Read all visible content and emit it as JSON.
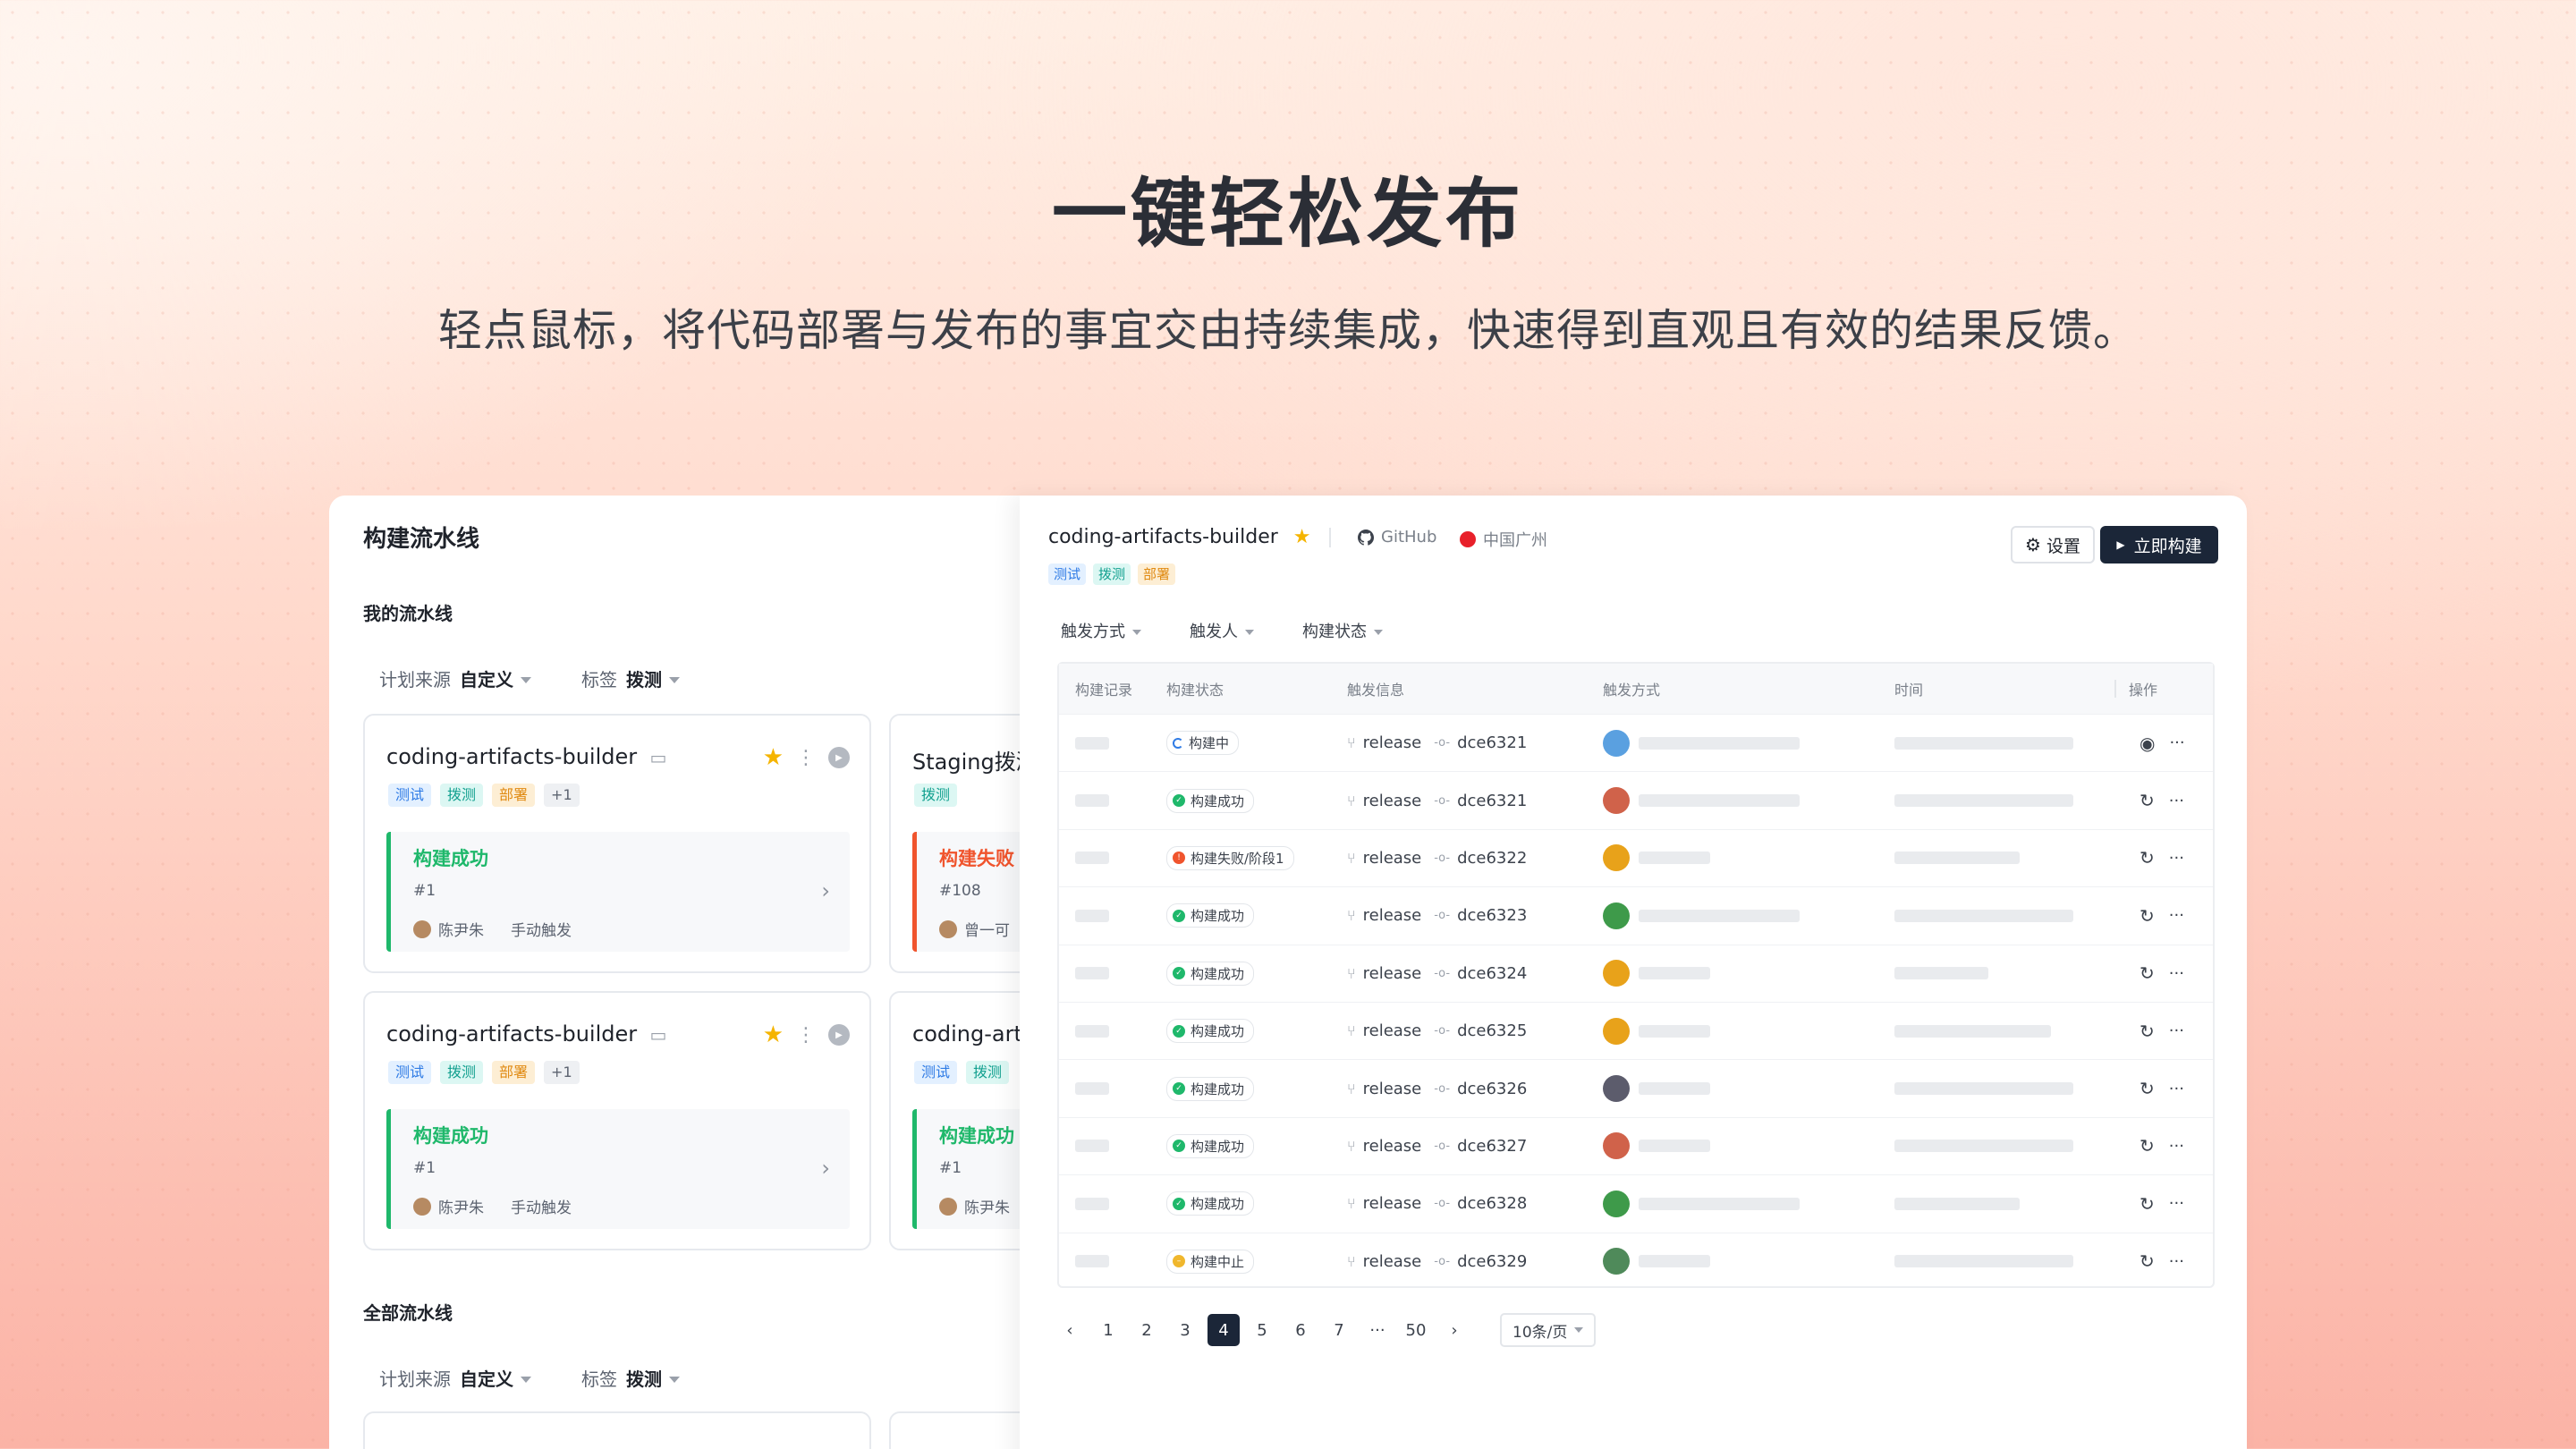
{
  "hero": {
    "title": "一键轻松发布",
    "subtitle": "轻点鼠标，将代码部署与发布的事宜交由持续集成，快速得到直观且有效的结果反馈。"
  },
  "left": {
    "title": "构建流水线",
    "my_section": "我的流水线",
    "all_section": "全部流水线",
    "filters": {
      "source_label": "计划来源",
      "source_value": "自定义",
      "tag_label": "标签",
      "tag_value": "拨测"
    },
    "cards": [
      {
        "name": "coding-artifacts-builder",
        "tags": [
          "测试",
          "拨测",
          "部署",
          "+1"
        ],
        "status": "构建成功",
        "status_color": "#1fb86b",
        "number": "#1",
        "user": "陈尹朱",
        "trigger": "手动触发",
        "starred": true
      },
      {
        "name": "Staging拨测",
        "tags": [
          "拨测"
        ],
        "status": "构建失败",
        "status_color": "#f0542d",
        "number": "#108",
        "user": "曾一可",
        "trigger": ""
      },
      {
        "name": "coding-artifacts-builder",
        "tags": [
          "测试",
          "拨测",
          "部署",
          "+1"
        ],
        "status": "构建成功",
        "status_color": "#1fb86b",
        "number": "#1",
        "user": "陈尹朱",
        "trigger": "手动触发",
        "starred": true
      },
      {
        "name": "coding-art",
        "tags": [
          "测试",
          "拨测"
        ],
        "status": "构建成功",
        "status_color": "#1fb86b",
        "number": "#1",
        "user": "陈尹朱",
        "trigger": ""
      }
    ]
  },
  "right": {
    "name": "coding-artifacts-builder",
    "source": "GitHub",
    "region": "中国广州",
    "tags": [
      "测试",
      "拨测",
      "部署"
    ],
    "settings_button": "设置",
    "build_button": "立即构建",
    "filters": [
      "触发方式",
      "触发人",
      "构建状态"
    ],
    "columns": [
      "构建记录",
      "构建状态",
      "触发信息",
      "触发方式",
      "时间",
      "操作"
    ],
    "rows": [
      {
        "status": "构建中",
        "color": "#2f7be5",
        "branch": "release",
        "commit": "dce6321",
        "avatar": "#5aa0e0",
        "w1": 180,
        "w2": 200
      },
      {
        "status": "构建成功",
        "color": "#1fb86b",
        "branch": "release",
        "commit": "dce6321",
        "avatar": "#d0624a",
        "w1": 180,
        "w2": 200
      },
      {
        "status": "构建失败/阶段1",
        "color": "#f0542d",
        "branch": "release",
        "commit": "dce6322",
        "avatar": "#e8a21a",
        "w1": 80,
        "w2": 140
      },
      {
        "status": "构建成功",
        "color": "#1fb86b",
        "branch": "release",
        "commit": "dce6323",
        "avatar": "#3e9a4a",
        "w1": 180,
        "w2": 200
      },
      {
        "status": "构建成功",
        "color": "#1fb86b",
        "branch": "release",
        "commit": "dce6324",
        "avatar": "#e8a21a",
        "w1": 80,
        "w2": 105
      },
      {
        "status": "构建成功",
        "color": "#1fb86b",
        "branch": "release",
        "commit": "dce6325",
        "avatar": "#e8a21a",
        "w1": 80,
        "w2": 175
      },
      {
        "status": "构建成功",
        "color": "#1fb86b",
        "branch": "release",
        "commit": "dce6326",
        "avatar": "#5c5c6c",
        "w1": 80,
        "w2": 200
      },
      {
        "status": "构建成功",
        "color": "#1fb86b",
        "branch": "release",
        "commit": "dce6327",
        "avatar": "#d0624a",
        "w1": 80,
        "w2": 200
      },
      {
        "status": "构建成功",
        "color": "#1fb86b",
        "branch": "release",
        "commit": "dce6328",
        "avatar": "#3e9a4a",
        "w1": 180,
        "w2": 140
      },
      {
        "status": "构建中止",
        "color": "#f0b72d",
        "branch": "release",
        "commit": "dce6329",
        "avatar": "#4f8a5a",
        "w1": 80,
        "w2": 200
      }
    ],
    "pager": {
      "pages": [
        "1",
        "2",
        "3",
        "4",
        "5",
        "6",
        "7",
        "···",
        "50"
      ],
      "active": "4",
      "page_size": "10条/页"
    }
  }
}
